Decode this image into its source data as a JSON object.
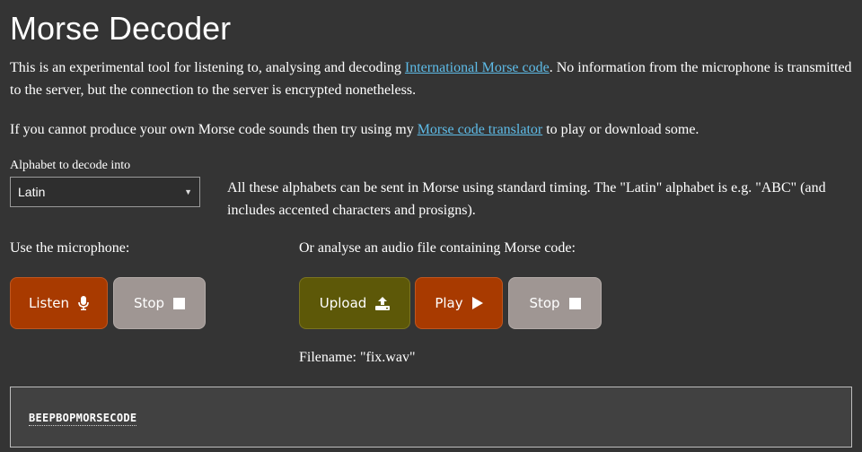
{
  "page": {
    "title": "Morse Decoder",
    "intro": {
      "before_link": "This is an experimental tool for listening to, analysing and decoding ",
      "link": "International Morse code",
      "after_link": ". No information from the microphone is transmitted to the server, but the connection to the server is encrypted nonetheless."
    },
    "intro2": {
      "before_link": "If you cannot produce your own Morse code sounds then try using my ",
      "link": "Morse code translator",
      "after_link": " to play or download some."
    }
  },
  "alphabet": {
    "label": "Alphabet to decode into",
    "selected": "Latin",
    "note": "All these alphabets can be sent in Morse using standard timing. The \"Latin\" alphabet is e.g. \"ABC\" (and includes accented characters and prosigns)."
  },
  "microphone": {
    "label": "Use the microphone:",
    "listen_label": "Listen",
    "stop_label": "Stop"
  },
  "file": {
    "label": "Or analyse an audio file containing Morse code:",
    "upload_label": "Upload",
    "play_label": "Play",
    "stop_label": "Stop",
    "filename": "Filename: \"fix.wav\""
  },
  "output": {
    "text": "BEEPBOPMORSECODE"
  },
  "colors": {
    "background": "#343434",
    "link": "#5ebce8",
    "button_orange": "#a83a00",
    "button_grey": "#9f9693",
    "button_olive": "#5d5808"
  },
  "icons": {
    "listen": "microphone-icon",
    "stop": "stop-square-icon",
    "upload": "upload-icon",
    "play": "play-triangle-icon",
    "select": "caret-down-icon"
  }
}
